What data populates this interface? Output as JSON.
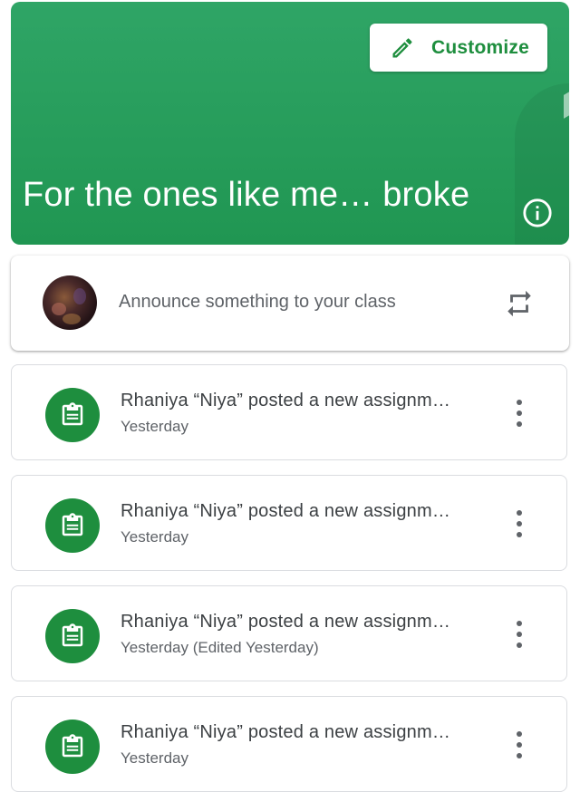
{
  "banner": {
    "class_title": "For the ones like me… broke",
    "customize_label": "Customize",
    "background_color": "#26a05b",
    "accent_color": "#1e8e3e"
  },
  "composer": {
    "placeholder": "Announce something to your class",
    "repost_icon": "repost-icon"
  },
  "stream": {
    "items": [
      {
        "title": "Rhaniya “Niya” posted a new assignm…",
        "subtitle": "Yesterday",
        "icon": "assignment-icon"
      },
      {
        "title": "Rhaniya “Niya” posted a new assignm…",
        "subtitle": "Yesterday",
        "icon": "assignment-icon"
      },
      {
        "title": "Rhaniya “Niya” posted a new assignm…",
        "subtitle": "Yesterday (Edited Yesterday)",
        "icon": "assignment-icon"
      },
      {
        "title": "Rhaniya “Niya” posted a new assignm…",
        "subtitle": "Yesterday",
        "icon": "assignment-icon"
      }
    ]
  }
}
